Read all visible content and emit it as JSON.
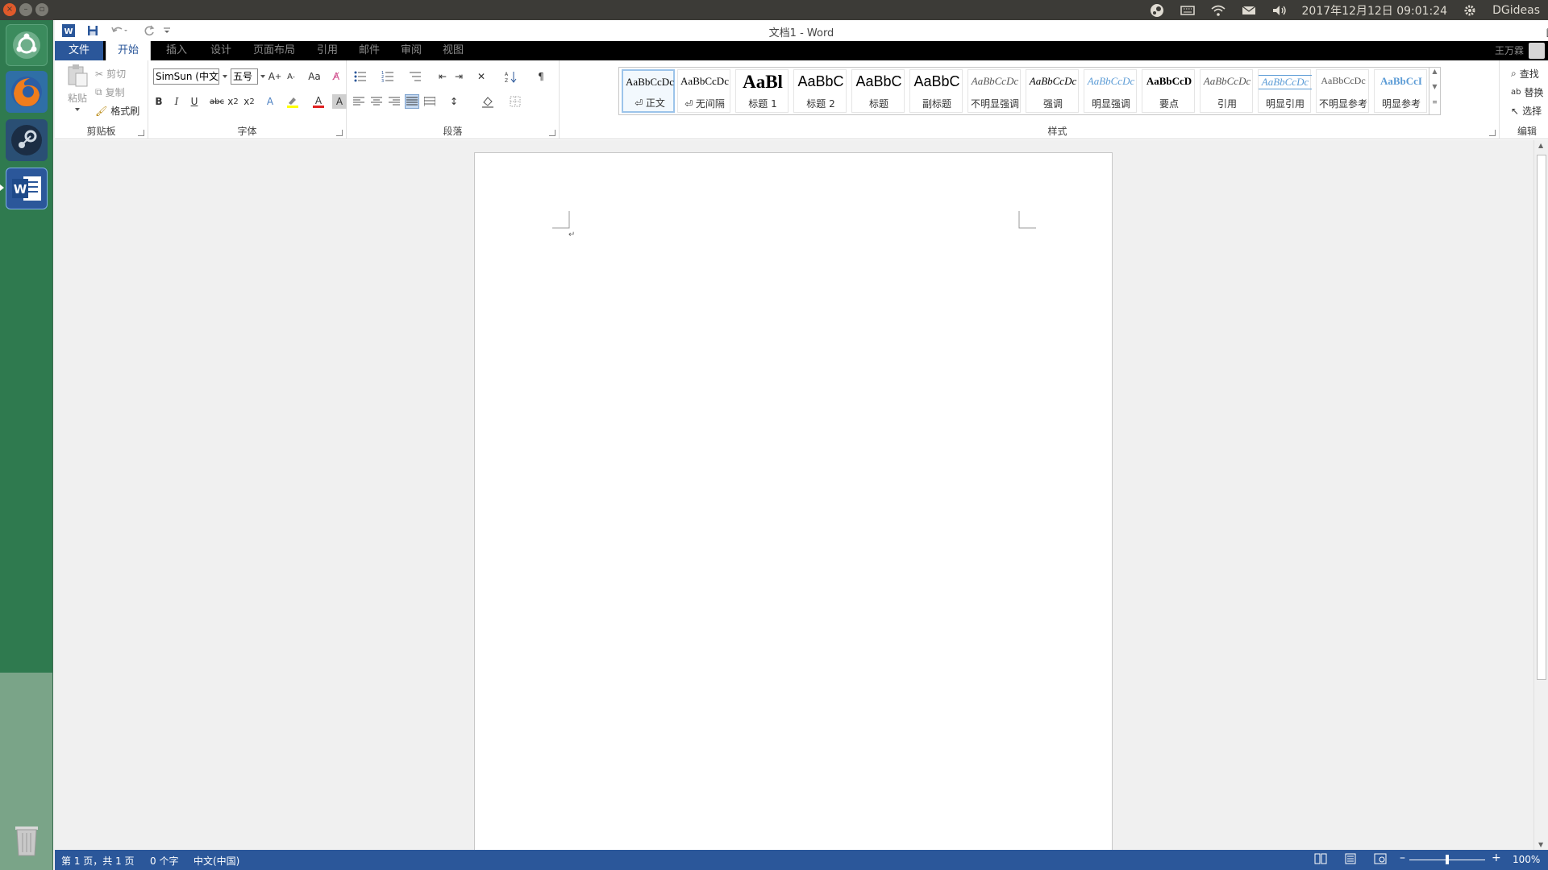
{
  "topbar": {
    "clock": "2017年12月12日 09:01:24",
    "user": "DGideas",
    "window_controls": [
      "×",
      "–",
      "▫"
    ],
    "icons": [
      "steam-tray-icon",
      "keyboard-icon",
      "wifi-icon",
      "mail-icon",
      "volume-icon",
      "gear-icon"
    ]
  },
  "launcher": {
    "items": [
      "Ubuntu Dash",
      "Firefox",
      "Steam",
      "Word",
      "Trash"
    ]
  },
  "window": {
    "title": "文档1 - Word",
    "account_name": "王万霖",
    "controls": [
      "?",
      "⊡",
      "–",
      "❐",
      "✕"
    ]
  },
  "tabs": [
    "文件",
    "开始",
    "插入",
    "设计",
    "页面布局",
    "引用",
    "邮件",
    "审阅",
    "视图"
  ],
  "ribbon": {
    "clipboard": {
      "label": "剪贴板",
      "paste": "粘贴",
      "cut": "剪切",
      "copy": "复制",
      "format_painter": "格式刷"
    },
    "font": {
      "label": "字体",
      "font_name": "SimSun (中文",
      "font_size": "五号"
    },
    "paragraph": {
      "label": "段落"
    },
    "styles": {
      "label": "样式",
      "items": [
        {
          "sample": "AaBbCcDc",
          "name": "⏎ 正文"
        },
        {
          "sample": "AaBbCcDc",
          "name": "⏎ 无间隔"
        },
        {
          "sample": "AaBl",
          "name": "标题 1"
        },
        {
          "sample": "AaBbC",
          "name": "标题 2"
        },
        {
          "sample": "AaBbC",
          "name": "标题"
        },
        {
          "sample": "AaBbC",
          "name": "副标题"
        },
        {
          "sample": "AaBbCcDc",
          "name": "不明显强调"
        },
        {
          "sample": "AaBbCcDc",
          "name": "强调"
        },
        {
          "sample": "AaBbCcDc",
          "name": "明显强调"
        },
        {
          "sample": "AaBbCcD",
          "name": "要点"
        },
        {
          "sample": "AaBbCcDc",
          "name": "引用"
        },
        {
          "sample": "AaBbCcDc",
          "name": "明显引用"
        },
        {
          "sample": "AaBbCcDc",
          "name": "不明显参考"
        },
        {
          "sample": "AaBbCcI",
          "name": "明显参考"
        }
      ]
    },
    "editing": {
      "label": "编辑",
      "find": "查找",
      "replace": "替换",
      "select": "选择"
    }
  },
  "statusbar": {
    "page": "第 1 页，共 1 页",
    "words": "0 个字",
    "language": "中文(中国)",
    "zoom": "100%"
  },
  "colors": {
    "word_blue": "#2b579a",
    "launcher_green": "#2f7a4f",
    "panel_dark": "#3c3b37"
  }
}
